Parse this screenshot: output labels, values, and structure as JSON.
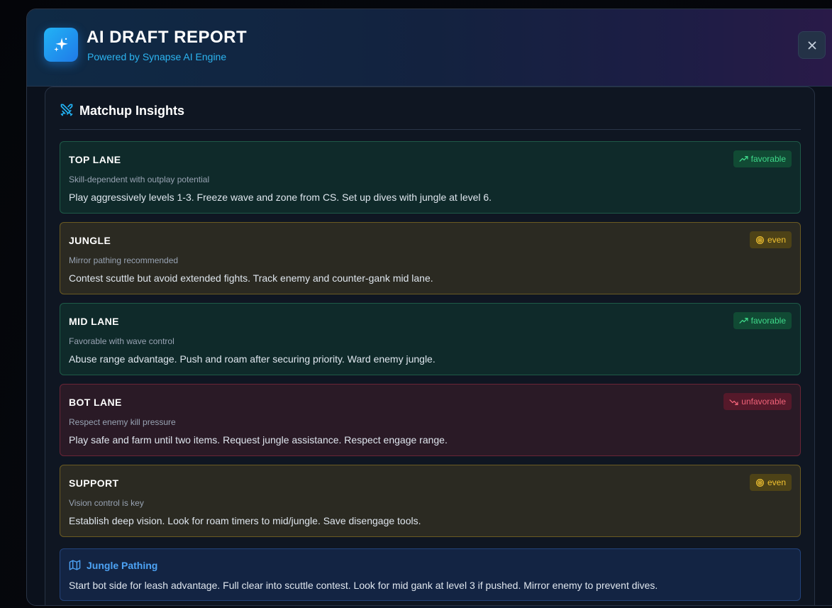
{
  "header": {
    "title": "AI DRAFT REPORT",
    "subtitle": "Powered by Synapse AI Engine"
  },
  "matchup": {
    "title": "Matchup Insights",
    "lanes": [
      {
        "name": "TOP LANE",
        "status": "favorable",
        "summary": "Skill-dependent with outplay potential",
        "advice": "Play aggressively levels 1-3. Freeze wave and zone from CS. Set up dives with jungle at level 6."
      },
      {
        "name": "JUNGLE",
        "status": "even",
        "summary": "Mirror pathing recommended",
        "advice": "Contest scuttle but avoid extended fights. Track enemy and counter-gank mid lane."
      },
      {
        "name": "MID LANE",
        "status": "favorable",
        "summary": "Favorable with wave control",
        "advice": "Abuse range advantage. Push and roam after securing priority. Ward enemy jungle."
      },
      {
        "name": "BOT LANE",
        "status": "unfavorable",
        "summary": "Respect enemy kill pressure",
        "advice": "Play safe and farm until two items. Request jungle assistance. Respect engage range."
      },
      {
        "name": "SUPPORT",
        "status": "even",
        "summary": "Vision control is key",
        "advice": "Establish deep vision. Look for roam timers to mid/jungle. Save disengage tools."
      }
    ]
  },
  "pathing": {
    "title": "Jungle Pathing",
    "text": "Start bot side for leash advantage. Full clear into scuttle contest. Look for mid gank at level 3 if pushed. Mirror enemy to prevent dives."
  },
  "icons": {
    "app": "sparkles-icon",
    "close": "close-icon",
    "matchup": "crossed-swords-icon",
    "favorable": "trending-up-icon",
    "even": "target-icon",
    "unfavorable": "trending-down-icon",
    "pathing": "map-icon"
  },
  "colors": {
    "accent": "#22b3f5",
    "favorable": "#3fd98a",
    "even": "#f3c331",
    "unfavorable": "#f06278",
    "pathing": "#4da3f5"
  }
}
